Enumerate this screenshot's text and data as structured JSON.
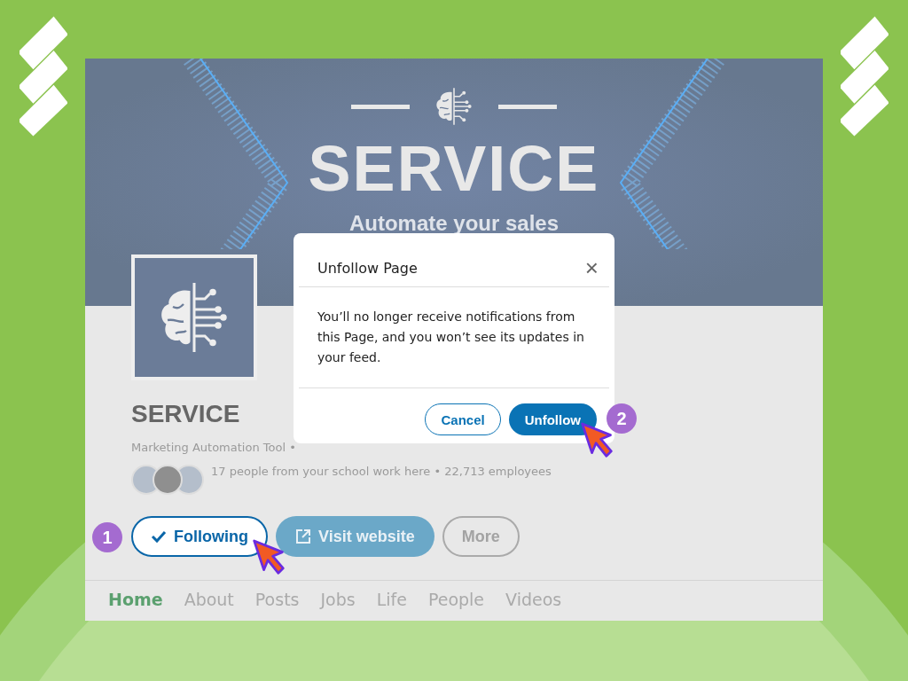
{
  "banner": {
    "title": "SERVICE",
    "subtitle": "Automate your sales"
  },
  "company": {
    "name": "SERVICE",
    "meta": "Marketing Automation Tool •",
    "connections": "17 people from your school work here • 22,713 employees"
  },
  "actions": [
    {
      "label": "Following",
      "kind": "following"
    },
    {
      "label": "Visit website",
      "kind": "website"
    },
    {
      "label": "More",
      "kind": "more"
    }
  ],
  "tabs": [
    {
      "label": "Home",
      "selected": true
    },
    {
      "label": "About",
      "selected": false
    },
    {
      "label": "Posts",
      "selected": false
    },
    {
      "label": "Jobs",
      "selected": false
    },
    {
      "label": "Life",
      "selected": false
    },
    {
      "label": "People",
      "selected": false
    },
    {
      "label": "Videos",
      "selected": false
    }
  ],
  "dialog": {
    "title": "Unfollow Page",
    "close": "×",
    "message": "You’ll no longer receive notifications from this Page, and you won’t see its updates in your feed.",
    "buttons": [
      {
        "label": "Cancel",
        "kind": "secondary"
      },
      {
        "label": "Unfollow",
        "kind": "primary"
      }
    ]
  },
  "steps": [
    {
      "number": "1"
    },
    {
      "number": "2"
    }
  ]
}
